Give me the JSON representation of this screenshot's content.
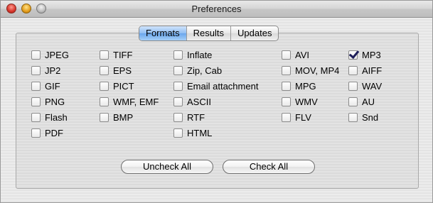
{
  "window": {
    "title": "Preferences"
  },
  "tabs": [
    {
      "label": "Formats",
      "active": true
    },
    {
      "label": "Results",
      "active": false
    },
    {
      "label": "Updates",
      "active": false
    }
  ],
  "formats": {
    "col1": [
      {
        "label": "JPEG",
        "checked": false
      },
      {
        "label": "JP2",
        "checked": false
      },
      {
        "label": "GIF",
        "checked": false
      },
      {
        "label": "PNG",
        "checked": false
      },
      {
        "label": "Flash",
        "checked": false
      },
      {
        "label": "PDF",
        "checked": false
      }
    ],
    "col2": [
      {
        "label": "TIFF",
        "checked": false
      },
      {
        "label": "EPS",
        "checked": false
      },
      {
        "label": "PICT",
        "checked": false
      },
      {
        "label": "WMF, EMF",
        "checked": false
      },
      {
        "label": "BMP",
        "checked": false
      }
    ],
    "col3": [
      {
        "label": "Inflate",
        "checked": false
      },
      {
        "label": "Zip, Cab",
        "checked": false
      },
      {
        "label": "Email attachment",
        "checked": false
      },
      {
        "label": "ASCII",
        "checked": false
      },
      {
        "label": "RTF",
        "checked": false
      },
      {
        "label": "HTML",
        "checked": false
      }
    ],
    "col4": [
      {
        "label": "AVI",
        "checked": false
      },
      {
        "label": "MOV, MP4",
        "checked": false
      },
      {
        "label": "MPG",
        "checked": false
      },
      {
        "label": "WMV",
        "checked": false
      },
      {
        "label": "FLV",
        "checked": false
      }
    ],
    "col5": [
      {
        "label": "MP3",
        "checked": true
      },
      {
        "label": "AIFF",
        "checked": false
      },
      {
        "label": "WAV",
        "checked": false
      },
      {
        "label": "AU",
        "checked": false
      },
      {
        "label": "Snd",
        "checked": false
      }
    ]
  },
  "buttons": {
    "uncheck_all": "Uncheck All",
    "check_all": "Check All"
  }
}
